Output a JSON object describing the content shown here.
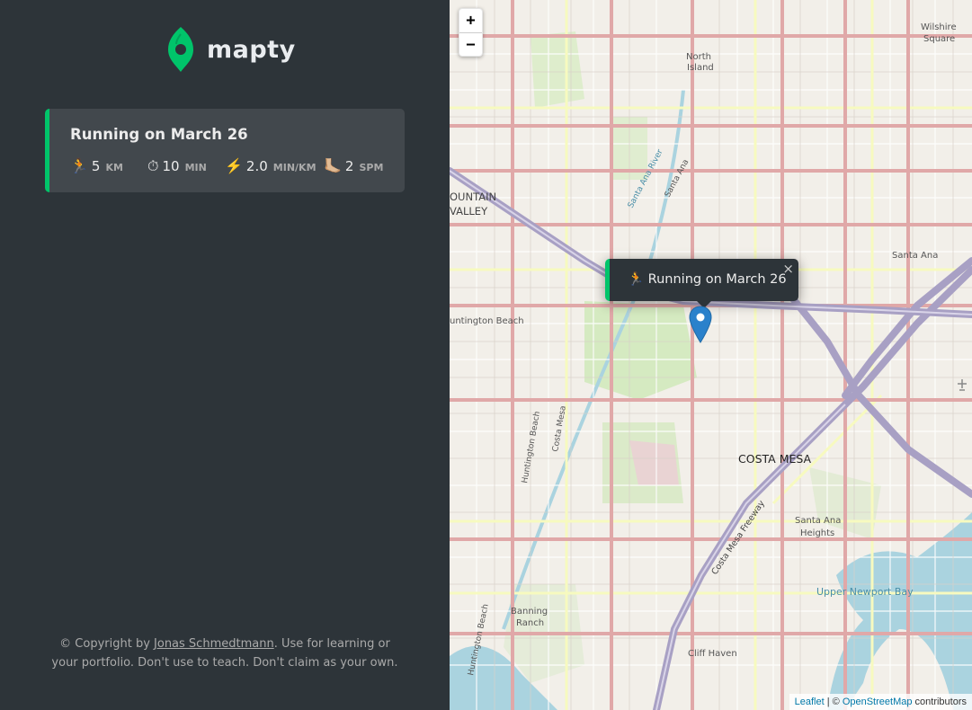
{
  "app": {
    "logo_text": "mapty",
    "brand_color": "#00c46a",
    "logo_icon": "map-pin-icon"
  },
  "workouts": [
    {
      "title": "Running on March 26",
      "type": "running",
      "details": [
        {
          "icon": "🏃",
          "icon_name": "runner-icon",
          "value": "5",
          "unit": "km"
        },
        {
          "icon": "⏱",
          "icon_name": "stopwatch-icon",
          "value": "10",
          "unit": "min"
        },
        {
          "icon": "⚡️",
          "icon_name": "lightning-icon",
          "value": "2.0",
          "unit": "min/km"
        },
        {
          "icon": "🦶🏼",
          "icon_name": "foot-icon",
          "value": "2",
          "unit": "spm"
        }
      ]
    }
  ],
  "copyright": {
    "prefix": "© Copyright by ",
    "author": "Jonas Schmedtmann",
    "suffix": ". Use for learning or your portfolio. Don't use to teach. Don't claim as your own."
  },
  "map": {
    "zoom_in": "+",
    "zoom_out": "−",
    "popup": {
      "icon": "🏃",
      "text": "Running on March 26",
      "close": "×"
    },
    "labels": {
      "north_island_1": "North",
      "north_island_2": "Island",
      "wilshire_1": "Wilshire",
      "wilshire_2": "Square",
      "fountain_1": "OUNTAIN",
      "fountain_2": "VALLEY",
      "santa_ana_river": "Santa Ana River",
      "santa_ana_road": "Santa Ana",
      "santa_ana_city": "Santa Ana",
      "huntington_beach_city": "untington Beach",
      "huntington_beach_road": "Huntington Beach",
      "costa_mesa_road": "Costa Mesa",
      "costa_mesa_city": "COSTA MESA",
      "costa_mesa_freeway": "Costa Mesa Freeway",
      "santa_ana_heights_1": "Santa Ana",
      "santa_ana_heights_2": "Heights",
      "banning_ranch_1": "Banning",
      "banning_ranch_2": "Ranch",
      "upper_newport_bay": "Upper Newport Bay",
      "cliff_haven": "Cliff Haven",
      "huntington_beach_coast": "Huntington Beach"
    },
    "attribution": {
      "leaflet": "Leaflet",
      "separator": " | © ",
      "osm": "OpenStreetMap",
      "suffix": " contributors"
    }
  }
}
